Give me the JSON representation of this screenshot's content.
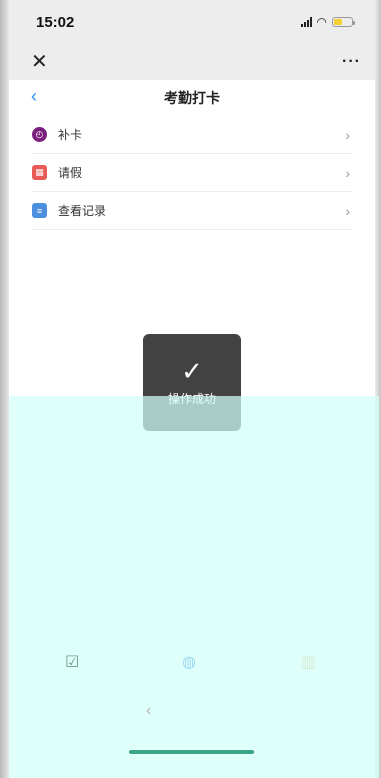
{
  "status_bar": {
    "time": "15:02",
    "icons": [
      "signal-icon",
      "wifi-icon",
      "battery-icon"
    ],
    "battery_color": "#f3d030"
  },
  "nav_bar": {
    "close_glyph": "✕",
    "more_glyph": "···"
  },
  "page": {
    "back_glyph": "‹",
    "title": "考勤打卡"
  },
  "menu": {
    "items": [
      {
        "label": "补卡",
        "icon": "clock-icon",
        "color": "#7b1f7f"
      },
      {
        "label": "请假",
        "icon": "calendar-icon",
        "color": "#e75a56"
      },
      {
        "label": "查看记录",
        "icon": "document-icon",
        "color": "#4c8fdf"
      }
    ],
    "chevron_glyph": "›"
  },
  "toast": {
    "check_glyph": "✓",
    "text": "操作成功"
  },
  "bottom_tabs": [
    {
      "icon": "calendar-check-icon",
      "glyph": "☑"
    },
    {
      "icon": "profile-icon",
      "glyph": "◍"
    },
    {
      "icon": "stats-icon",
      "glyph": "▥"
    }
  ],
  "bottom_back_glyph": "‹",
  "colors": {
    "accent": "#2a8cf0",
    "overlay": "#d2fff8",
    "home_indicator": "#3ea586"
  }
}
